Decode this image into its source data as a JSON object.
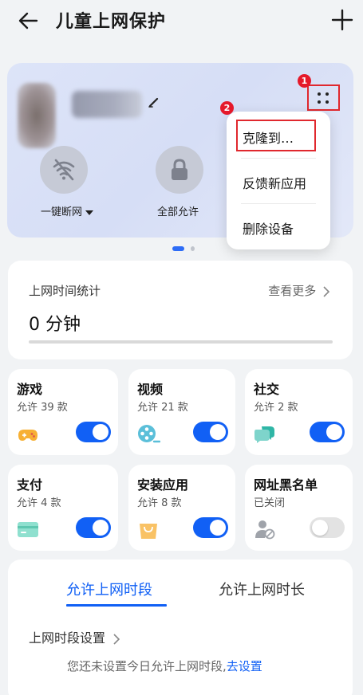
{
  "header": {
    "title": "儿童上网保护"
  },
  "device": {
    "controls": [
      {
        "label": "一键断网",
        "icon": "wifi-off-icon"
      },
      {
        "label": "全部允许",
        "icon": "lock-icon"
      }
    ],
    "badges": [
      "1",
      "2"
    ]
  },
  "menu": {
    "items": [
      "克隆到…",
      "反馈新应用",
      "删除设备"
    ]
  },
  "time_stats": {
    "title": "上网时间统计",
    "more": "查看更多",
    "value": "0 分钟"
  },
  "categories": [
    {
      "name": "游戏",
      "sub": "允许 39 款",
      "icon": "gamepad-icon",
      "on": true
    },
    {
      "name": "视频",
      "sub": "允许 21 款",
      "icon": "video-reel-icon",
      "on": true
    },
    {
      "name": "社交",
      "sub": "允许 2 款",
      "icon": "chat-bubbles-icon",
      "on": true
    },
    {
      "name": "支付",
      "sub": "允许 4 款",
      "icon": "card-icon",
      "on": true
    },
    {
      "name": "安装应用",
      "sub": "允许 8 款",
      "icon": "shopping-bag-icon",
      "on": true
    },
    {
      "name": "网址黑名单",
      "sub": "已关闭",
      "icon": "user-blocked-icon",
      "on": false
    }
  ],
  "period": {
    "tabs": [
      "允许上网时段",
      "允许上网时长"
    ],
    "setting": "上网时段设置",
    "note": "您还未设置今日允许上网时段,",
    "link": "去设置"
  },
  "colors": {
    "accent": "#1160f5",
    "highlight": "#e0282e"
  }
}
